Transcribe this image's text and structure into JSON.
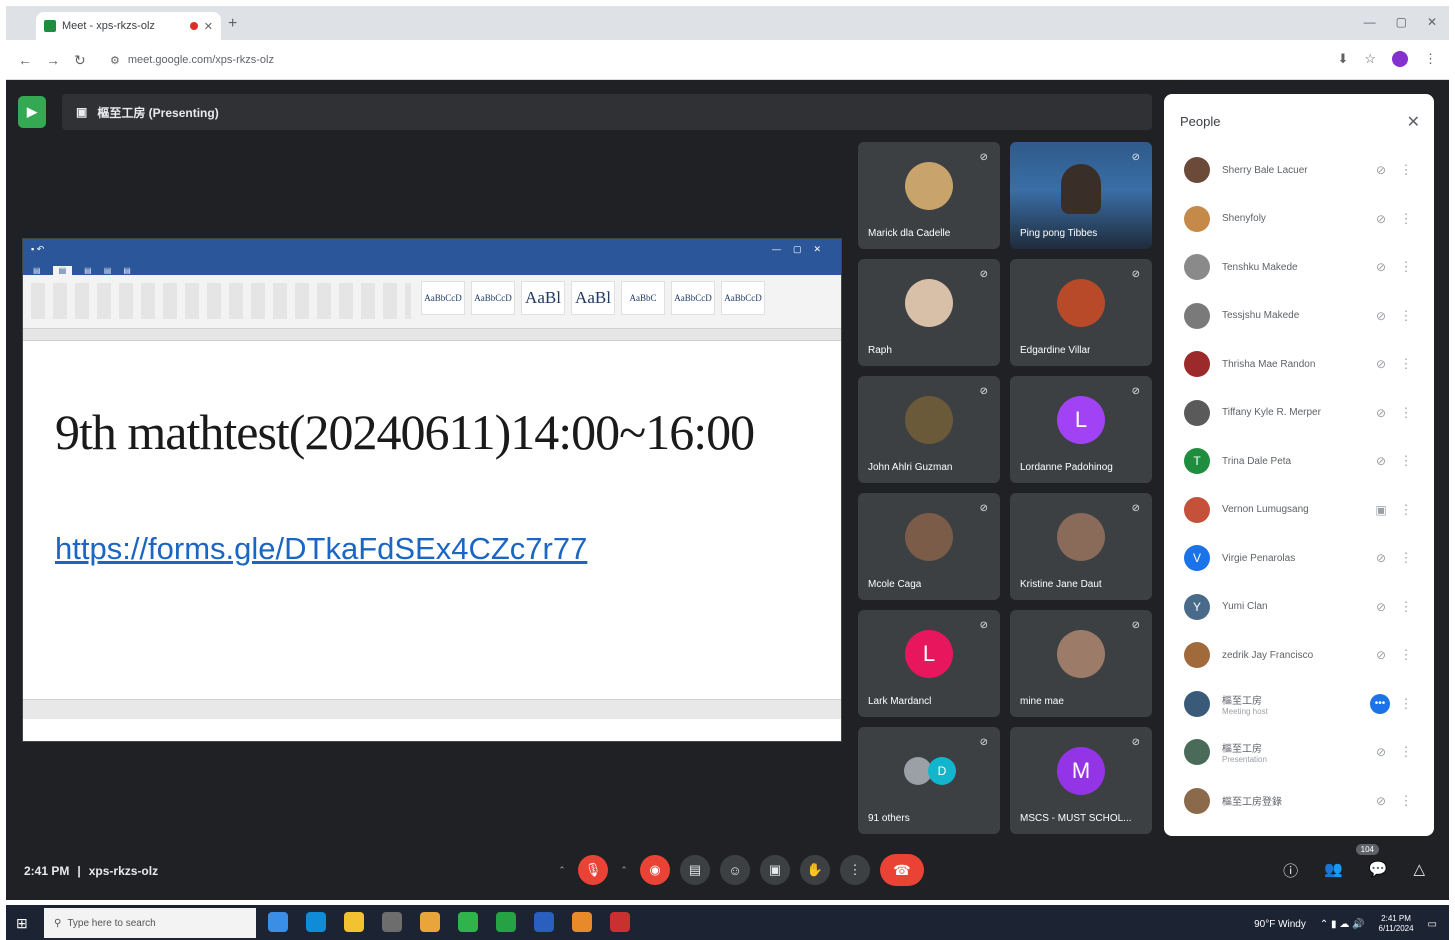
{
  "browser": {
    "tab_title": "Meet - xps-rkzs-olz",
    "url": "meet.google.com/xps-rkzs-olz"
  },
  "meet": {
    "presenting_label": "樞至工房 (Presenting)",
    "time": "2:41 PM",
    "meeting_code": "xps-rkzs-olz",
    "participant_badge": "104"
  },
  "shared_doc": {
    "heading": "9th mathtest(20240611)14:00~16:00",
    "link": "https://forms.gle/DTkaFdSEx4CZc7r77",
    "styles": [
      "AaBbCcD",
      "AaBbCcD",
      "AaBl",
      "AaBl",
      "AaBbC",
      "AaBbCcD",
      "AaBbCcD"
    ]
  },
  "tiles": [
    {
      "name": "Marick dla Cadelle",
      "kind": "photo",
      "color": "#c9a36c"
    },
    {
      "name": "Ping pong Tibbes",
      "kind": "video",
      "color": "#3a6ea6"
    },
    {
      "name": "Raph",
      "kind": "photo",
      "color": "#d8c0a8"
    },
    {
      "name": "Edgardine Villar",
      "kind": "photo",
      "color": "#b84a2a"
    },
    {
      "name": "John Ahlri Guzman",
      "kind": "photo",
      "color": "#6b5a3a"
    },
    {
      "name": "Lordanne Padohinog",
      "kind": "letter",
      "letter": "L",
      "color": "#a142f4"
    },
    {
      "name": "Mcole Caga",
      "kind": "photo",
      "color": "#7a5c48"
    },
    {
      "name": "Kristine Jane Daut",
      "kind": "photo",
      "color": "#8a6a58"
    },
    {
      "name": "Lark Mardancl",
      "kind": "letter",
      "letter": "L",
      "color": "#e8175d"
    },
    {
      "name": "mine mae",
      "kind": "photo",
      "color": "#9c7c68"
    },
    {
      "name": "91 others",
      "kind": "group",
      "letter": "D",
      "color": "#12b5cb"
    },
    {
      "name": "MSCS - MUST SCHOL...",
      "kind": "letter",
      "letter": "M",
      "color": "#9334e6"
    }
  ],
  "people_panel": {
    "title": "People",
    "close_icon": "close-icon",
    "rows": [
      {
        "name": "Sherry Bale Lacuer",
        "sub": "",
        "color": "#6b4a3a",
        "letter": ""
      },
      {
        "name": "Shenyfoly",
        "sub": "",
        "color": "#c58a4a",
        "letter": ""
      },
      {
        "name": "Tenshku Makede",
        "sub": "",
        "color": "#8a8a8a",
        "letter": ""
      },
      {
        "name": "Tessjshu Makede",
        "sub": "",
        "color": "#7a7a7a",
        "letter": ""
      },
      {
        "name": "Thrisha Mae Randon",
        "sub": "",
        "color": "#9c2a2a",
        "letter": ""
      },
      {
        "name": "Tiffany Kyle R. Merper",
        "sub": "",
        "color": "#5a5a5a",
        "letter": ""
      },
      {
        "name": "Trina Dale Peta",
        "sub": "",
        "color": "#1e8e3e",
        "letter": "T"
      },
      {
        "name": "Vernon Lumugsang",
        "sub": "",
        "color": "#c5513a",
        "letter": ""
      },
      {
        "name": "Virgie Penarolas",
        "sub": "",
        "color": "#1a73e8",
        "letter": "V"
      },
      {
        "name": "Yumi Clan",
        "sub": "",
        "color": "#4a6a8a",
        "letter": "Y"
      },
      {
        "name": "zedrik Jay Francisco",
        "sub": "",
        "color": "#a06a3a",
        "letter": ""
      },
      {
        "name": "樞至工房",
        "sub": "Meeting host",
        "color": "#3a5a7a",
        "letter": ""
      },
      {
        "name": "樞至工房",
        "sub": "Presentation",
        "color": "#4a6a5a",
        "letter": ""
      },
      {
        "name": "樞至工房登錄",
        "sub": "",
        "color": "#8a6a4a",
        "letter": ""
      }
    ]
  },
  "taskbar": {
    "search_placeholder": "Type here to search",
    "weather": "90°F Windy",
    "clock_time": "2:41 PM",
    "clock_date": "6/11/2024"
  }
}
